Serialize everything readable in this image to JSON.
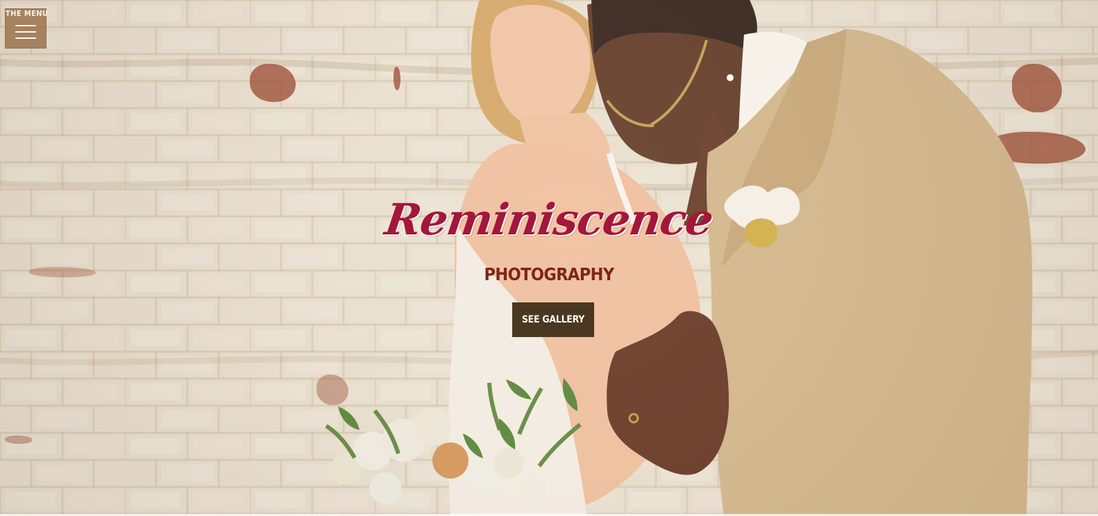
{
  "page": {
    "menu_label": "THE MENU",
    "hero_title": "Reminiscence",
    "hero_subtitle": "PHOTOGRAPHY",
    "cta_label": "SEE GALLERY"
  },
  "icons": {
    "menu": "hamburger-menu-icon"
  },
  "colors": {
    "title": "#a4163a",
    "subtitle": "#7f2617",
    "button_bg": "#4a3721",
    "menu_bg": "#9e7651"
  }
}
